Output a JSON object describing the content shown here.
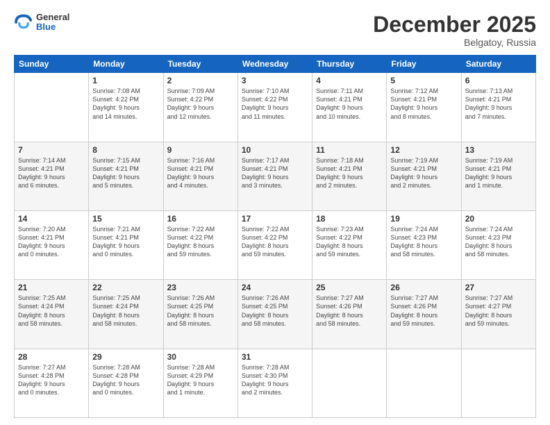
{
  "header": {
    "logo": {
      "general": "General",
      "blue": "Blue"
    },
    "title": "December 2025",
    "location": "Belgatoy, Russia"
  },
  "days_of_week": [
    "Sunday",
    "Monday",
    "Tuesday",
    "Wednesday",
    "Thursday",
    "Friday",
    "Saturday"
  ],
  "weeks": [
    [
      {
        "num": "",
        "info": ""
      },
      {
        "num": "1",
        "info": "Sunrise: 7:08 AM\nSunset: 4:22 PM\nDaylight: 9 hours\nand 14 minutes."
      },
      {
        "num": "2",
        "info": "Sunrise: 7:09 AM\nSunset: 4:22 PM\nDaylight: 9 hours\nand 12 minutes."
      },
      {
        "num": "3",
        "info": "Sunrise: 7:10 AM\nSunset: 4:22 PM\nDaylight: 9 hours\nand 11 minutes."
      },
      {
        "num": "4",
        "info": "Sunrise: 7:11 AM\nSunset: 4:21 PM\nDaylight: 9 hours\nand 10 minutes."
      },
      {
        "num": "5",
        "info": "Sunrise: 7:12 AM\nSunset: 4:21 PM\nDaylight: 9 hours\nand 8 minutes."
      },
      {
        "num": "6",
        "info": "Sunrise: 7:13 AM\nSunset: 4:21 PM\nDaylight: 9 hours\nand 7 minutes."
      }
    ],
    [
      {
        "num": "7",
        "info": "Sunrise: 7:14 AM\nSunset: 4:21 PM\nDaylight: 9 hours\nand 6 minutes."
      },
      {
        "num": "8",
        "info": "Sunrise: 7:15 AM\nSunset: 4:21 PM\nDaylight: 9 hours\nand 5 minutes."
      },
      {
        "num": "9",
        "info": "Sunrise: 7:16 AM\nSunset: 4:21 PM\nDaylight: 9 hours\nand 4 minutes."
      },
      {
        "num": "10",
        "info": "Sunrise: 7:17 AM\nSunset: 4:21 PM\nDaylight: 9 hours\nand 3 minutes."
      },
      {
        "num": "11",
        "info": "Sunrise: 7:18 AM\nSunset: 4:21 PM\nDaylight: 9 hours\nand 2 minutes."
      },
      {
        "num": "12",
        "info": "Sunrise: 7:19 AM\nSunset: 4:21 PM\nDaylight: 9 hours\nand 2 minutes."
      },
      {
        "num": "13",
        "info": "Sunrise: 7:19 AM\nSunset: 4:21 PM\nDaylight: 9 hours\nand 1 minute."
      }
    ],
    [
      {
        "num": "14",
        "info": "Sunrise: 7:20 AM\nSunset: 4:21 PM\nDaylight: 9 hours\nand 0 minutes."
      },
      {
        "num": "15",
        "info": "Sunrise: 7:21 AM\nSunset: 4:21 PM\nDaylight: 9 hours\nand 0 minutes."
      },
      {
        "num": "16",
        "info": "Sunrise: 7:22 AM\nSunset: 4:22 PM\nDaylight: 8 hours\nand 59 minutes."
      },
      {
        "num": "17",
        "info": "Sunrise: 7:22 AM\nSunset: 4:22 PM\nDaylight: 8 hours\nand 59 minutes."
      },
      {
        "num": "18",
        "info": "Sunrise: 7:23 AM\nSunset: 4:22 PM\nDaylight: 8 hours\nand 59 minutes."
      },
      {
        "num": "19",
        "info": "Sunrise: 7:24 AM\nSunset: 4:23 PM\nDaylight: 8 hours\nand 58 minutes."
      },
      {
        "num": "20",
        "info": "Sunrise: 7:24 AM\nSunset: 4:23 PM\nDaylight: 8 hours\nand 58 minutes."
      }
    ],
    [
      {
        "num": "21",
        "info": "Sunrise: 7:25 AM\nSunset: 4:24 PM\nDaylight: 8 hours\nand 58 minutes."
      },
      {
        "num": "22",
        "info": "Sunrise: 7:25 AM\nSunset: 4:24 PM\nDaylight: 8 hours\nand 58 minutes."
      },
      {
        "num": "23",
        "info": "Sunrise: 7:26 AM\nSunset: 4:25 PM\nDaylight: 8 hours\nand 58 minutes."
      },
      {
        "num": "24",
        "info": "Sunrise: 7:26 AM\nSunset: 4:25 PM\nDaylight: 8 hours\nand 58 minutes."
      },
      {
        "num": "25",
        "info": "Sunrise: 7:27 AM\nSunset: 4:26 PM\nDaylight: 8 hours\nand 58 minutes."
      },
      {
        "num": "26",
        "info": "Sunrise: 7:27 AM\nSunset: 4:26 PM\nDaylight: 8 hours\nand 59 minutes."
      },
      {
        "num": "27",
        "info": "Sunrise: 7:27 AM\nSunset: 4:27 PM\nDaylight: 8 hours\nand 59 minutes."
      }
    ],
    [
      {
        "num": "28",
        "info": "Sunrise: 7:27 AM\nSunset: 4:28 PM\nDaylight: 9 hours\nand 0 minutes."
      },
      {
        "num": "29",
        "info": "Sunrise: 7:28 AM\nSunset: 4:28 PM\nDaylight: 9 hours\nand 0 minutes."
      },
      {
        "num": "30",
        "info": "Sunrise: 7:28 AM\nSunset: 4:29 PM\nDaylight: 9 hours\nand 1 minute."
      },
      {
        "num": "31",
        "info": "Sunrise: 7:28 AM\nSunset: 4:30 PM\nDaylight: 9 hours\nand 2 minutes."
      },
      {
        "num": "",
        "info": ""
      },
      {
        "num": "",
        "info": ""
      },
      {
        "num": "",
        "info": ""
      }
    ]
  ]
}
